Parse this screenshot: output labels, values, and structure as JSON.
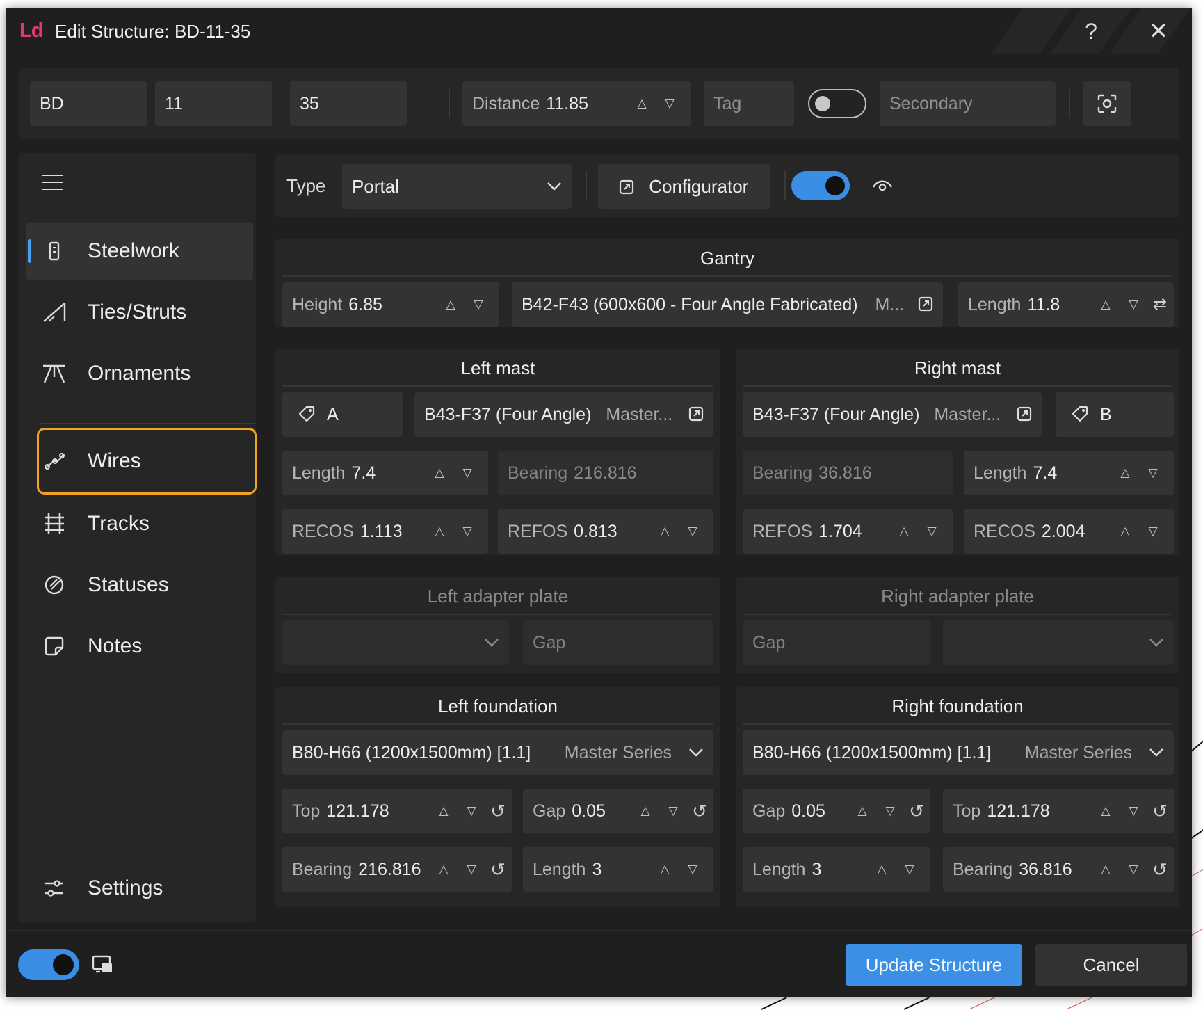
{
  "window": {
    "logo": "Ld",
    "title": "Edit Structure: BD-11-35",
    "help_icon": "?",
    "close_icon": "✕"
  },
  "topbar": {
    "code1": "BD",
    "code2": "11",
    "code3": "35",
    "distance_label": "Distance",
    "distance_value": "11.85",
    "tag_placeholder": "Tag",
    "secondary_placeholder": "Secondary"
  },
  "sidebar": {
    "items": [
      {
        "label": "Steelwork",
        "icon": "steelwork-icon"
      },
      {
        "label": "Ties/Struts",
        "icon": "ties-icon"
      },
      {
        "label": "Ornaments",
        "icon": "ornaments-icon"
      },
      {
        "label": "Wires",
        "icon": "wires-icon"
      },
      {
        "label": "Tracks",
        "icon": "tracks-icon"
      },
      {
        "label": "Statuses",
        "icon": "statuses-icon"
      },
      {
        "label": "Notes",
        "icon": "notes-icon"
      }
    ],
    "settings_label": "Settings"
  },
  "typebar": {
    "type_label": "Type",
    "type_value": "Portal",
    "configurator_label": "Configurator"
  },
  "gantry": {
    "title": "Gantry",
    "height_label": "Height",
    "height_value": "6.85",
    "beam_name": "B42-F43 (600x600 - Four Angle Fabricated)",
    "beam_series": "M...",
    "length_label": "Length",
    "length_value": "11.8"
  },
  "left_mast": {
    "title": "Left mast",
    "tag": "A",
    "mast_name": "B43-F37 (Four Angle)",
    "mast_series": "Master...",
    "length_label": "Length",
    "length_value": "7.4",
    "bearing_label": "Bearing",
    "bearing_value": "216.816",
    "recos_label": "RECOS",
    "recos_value": "1.113",
    "refos_label": "REFOS",
    "refos_value": "0.813"
  },
  "right_mast": {
    "title": "Right mast",
    "tag": "B",
    "mast_name": "B43-F37 (Four Angle)",
    "mast_series": "Master...",
    "bearing_label": "Bearing",
    "bearing_value": "36.816",
    "length_label": "Length",
    "length_value": "7.4",
    "refos_label": "REFOS",
    "refos_value": "1.704",
    "recos_label": "RECOS",
    "recos_value": "2.004"
  },
  "left_adapter": {
    "title": "Left adapter plate",
    "gap_placeholder": "Gap"
  },
  "right_adapter": {
    "title": "Right adapter plate",
    "gap_placeholder": "Gap"
  },
  "left_foundation": {
    "title": "Left foundation",
    "name": "B80-H66 (1200x1500mm) [1.1]",
    "series": "Master Series",
    "top_label": "Top",
    "top_value": "121.178",
    "gap_label": "Gap",
    "gap_value": "0.05",
    "bearing_label": "Bearing",
    "bearing_value": "216.816",
    "length_label": "Length",
    "length_value": "3"
  },
  "right_foundation": {
    "title": "Right foundation",
    "name": "B80-H66 (1200x1500mm) [1.1]",
    "series": "Master Series",
    "gap_label": "Gap",
    "gap_value": "0.05",
    "top_label": "Top",
    "top_value": "121.178",
    "length_label": "Length",
    "length_value": "3",
    "bearing_label": "Bearing",
    "bearing_value": "36.816"
  },
  "footer": {
    "update_label": "Update Structure",
    "cancel_label": "Cancel"
  },
  "colors": {
    "accent": "#3b8fe4",
    "highlight": "#f2a421",
    "logo": "#e0367a"
  }
}
